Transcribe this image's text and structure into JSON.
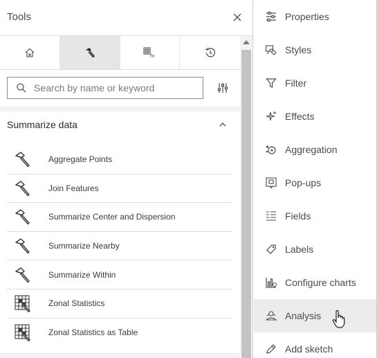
{
  "tools_panel": {
    "title": "Tools",
    "tabs": [
      {
        "icon": "home-icon"
      },
      {
        "icon": "hammer-icon",
        "active": true
      },
      {
        "icon": "function-grid-icon"
      },
      {
        "icon": "history-icon"
      }
    ],
    "search": {
      "placeholder": "Search by name or keyword"
    },
    "section": {
      "title": "Summarize data",
      "expanded": true
    },
    "tools": [
      {
        "label": "Aggregate Points",
        "icon": "hammer-icon"
      },
      {
        "label": "Join Features",
        "icon": "hammer-icon"
      },
      {
        "label": "Summarize Center and Dispersion",
        "icon": "hammer-icon"
      },
      {
        "label": "Summarize Nearby",
        "icon": "hammer-icon"
      },
      {
        "label": "Summarize Within",
        "icon": "hammer-icon"
      },
      {
        "label": "Zonal Statistics",
        "icon": "raster-tool-icon"
      },
      {
        "label": "Zonal Statistics as Table",
        "icon": "raster-tool-icon"
      }
    ]
  },
  "side_panel": {
    "items": [
      {
        "label": "Properties",
        "icon": "sliders-icon"
      },
      {
        "label": "Styles",
        "icon": "styles-icon"
      },
      {
        "label": "Filter",
        "icon": "filter-icon"
      },
      {
        "label": "Effects",
        "icon": "sparkle-icon"
      },
      {
        "label": "Aggregation",
        "icon": "aggregation-icon"
      },
      {
        "label": "Pop-ups",
        "icon": "popup-icon"
      },
      {
        "label": "Fields",
        "icon": "fields-icon"
      },
      {
        "label": "Labels",
        "icon": "label-tag-icon"
      },
      {
        "label": "Configure charts",
        "icon": "chart-icon"
      },
      {
        "label": "Analysis",
        "icon": "analysis-icon",
        "active": true
      },
      {
        "label": "Add sketch",
        "icon": "pencil-icon"
      }
    ]
  },
  "colors": {
    "active_background": "#e6e6e6",
    "border": "#dcdcdc",
    "text": "#323232"
  }
}
